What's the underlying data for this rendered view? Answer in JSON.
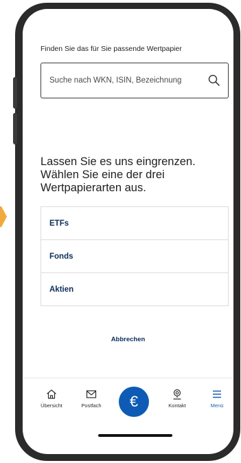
{
  "page": {
    "headline": "Finden Sie das für Sie passende Wertpapier"
  },
  "search": {
    "placeholder": "Suche nach WKN, ISIN, Bezeichnung"
  },
  "prompt": {
    "text": "Lassen Sie es uns eingrenzen. Wählen Sie eine der drei Wertpapierarten aus."
  },
  "security_types": [
    {
      "label": "ETFs"
    },
    {
      "label": "Fonds"
    },
    {
      "label": "Aktien"
    }
  ],
  "cancel_label": "Abbrechen",
  "tabbar": {
    "overview": {
      "label": "Übersicht",
      "icon": "home-icon"
    },
    "mailbox": {
      "label": "Postfach",
      "icon": "mail-icon"
    },
    "fab": {
      "label": "€",
      "icon": "euro-icon"
    },
    "contact": {
      "label": "Kontakt",
      "icon": "contact-icon"
    },
    "menu": {
      "label": "Menü",
      "icon": "menu-icon"
    }
  },
  "colors": {
    "brand_blue": "#0d5bb5",
    "text_navy": "#0d2e5a",
    "active_tab": "#1a5fb0",
    "accent_orange": "#f2a93b"
  }
}
